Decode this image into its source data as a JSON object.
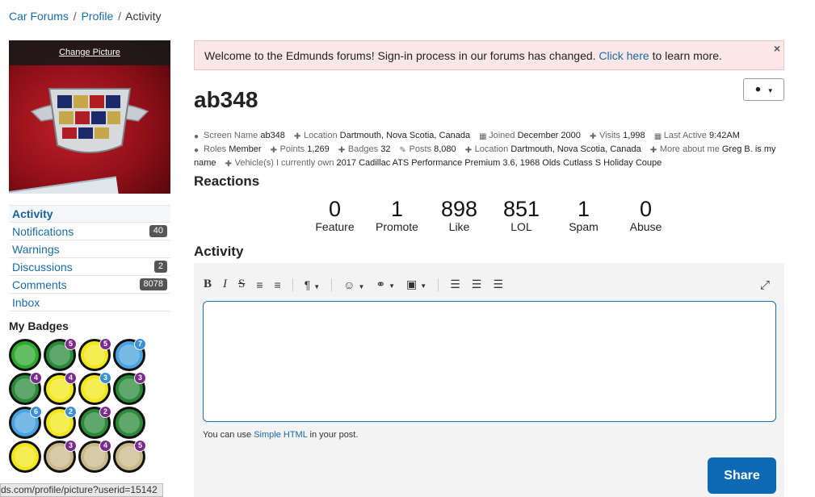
{
  "breadcrumb": {
    "car_forums": "Car Forums",
    "profile": "Profile",
    "current": "Activity",
    "sep": "/"
  },
  "profile_picture": {
    "change_label": "Change Picture"
  },
  "side_nav": [
    {
      "label": "Activity",
      "count": ""
    },
    {
      "label": "Notifications",
      "count": "40"
    },
    {
      "label": "Warnings",
      "count": ""
    },
    {
      "label": "Discussions",
      "count": "2"
    },
    {
      "label": "Comments",
      "count": "8078"
    },
    {
      "label": "Inbox",
      "count": ""
    }
  ],
  "badges": {
    "title": "My Badges",
    "items": [
      {
        "icon": "check-badge-icon",
        "num": "",
        "color": "#2fa82f"
      },
      {
        "icon": "thumbs-up-badge-icon",
        "num": "5",
        "color": "#2a8a3a"
      },
      {
        "icon": "smiley-badge-icon",
        "num": "5",
        "color": "#f1e71a"
      },
      {
        "icon": "comment-badge-icon",
        "num": "7",
        "color": "#4aa3df"
      },
      {
        "icon": "thumbs-up-badge-icon",
        "num": "4",
        "color": "#2a8a3a"
      },
      {
        "icon": "smiley-badge-icon",
        "num": "4",
        "color": "#f1e71a"
      },
      {
        "icon": "smiley-badge-icon",
        "num": "3",
        "color": "#f1e71a"
      },
      {
        "icon": "thumbs-up-badge-icon",
        "num": "3",
        "color": "#2a8a3a"
      },
      {
        "icon": "comment-badge-icon",
        "num": "6",
        "color": "#4aa3df"
      },
      {
        "icon": "smiley-badge-icon",
        "num": "2",
        "color": "#f1e71a"
      },
      {
        "icon": "thumbs-up-badge-icon",
        "num": "2",
        "color": "#2a8a3a"
      },
      {
        "icon": "thumbs-up-badge-icon",
        "num": "",
        "color": "#2a8a3a"
      },
      {
        "icon": "smiley-badge-icon",
        "num": "",
        "color": "#f1e71a"
      },
      {
        "icon": "cake-badge-icon",
        "num": "3",
        "color": "#c9b98a"
      },
      {
        "icon": "cake-badge-icon",
        "num": "4",
        "color": "#c9b98a"
      },
      {
        "icon": "cake-badge-icon",
        "num": "5",
        "color": "#c9b98a"
      }
    ]
  },
  "status_bar": "ds.com/profile/picture?userid=15142",
  "alert": {
    "text_before": "Welcome to the Edmunds forums! Sign-in process in our forums has changed.",
    "link": "Click here",
    "text_after": "to learn more.",
    "close": "×"
  },
  "username": "ab348",
  "meta": {
    "screen_name_label": "Screen Name",
    "screen_name": "ab348",
    "location_label": "Location",
    "location": "Dartmouth, Nova Scotia, Canada",
    "joined_label": "Joined",
    "joined": "December 2000",
    "visits_label": "Visits",
    "visits": "1,998",
    "last_active_label": "Last Active",
    "last_active": "9:42AM",
    "roles_label": "Roles",
    "roles": "Member",
    "points_label": "Points",
    "points": "1,269",
    "badges_label": "Badges",
    "badges": "32",
    "posts_label": "Posts",
    "posts": "8,080",
    "location2_label": "Location",
    "location2": "Dartmouth, Nova Scotia, Canada",
    "more_label": "More about me",
    "more": "Greg B. is my name",
    "vehicles_label": "Vehicle(s) I currently own",
    "vehicles": "2017 Cadillac ATS Performance Premium 3.6, 1968 Olds Cutlass S Holiday Coupe"
  },
  "reactions": {
    "title": "Reactions",
    "items": [
      {
        "value": "0",
        "label": "Feature"
      },
      {
        "value": "1",
        "label": "Promote"
      },
      {
        "value": "898",
        "label": "Like"
      },
      {
        "value": "851",
        "label": "LOL"
      },
      {
        "value": "1",
        "label": "Spam"
      },
      {
        "value": "0",
        "label": "Abuse"
      }
    ]
  },
  "activity": {
    "title": "Activity",
    "hint_before": "You can use",
    "hint_link": "Simple HTML",
    "hint_after": "in your post.",
    "share": "Share"
  },
  "colors": {
    "link": "#1a6aa8",
    "share": "#0c69b4",
    "alert_bg": "#fbe7e7"
  }
}
